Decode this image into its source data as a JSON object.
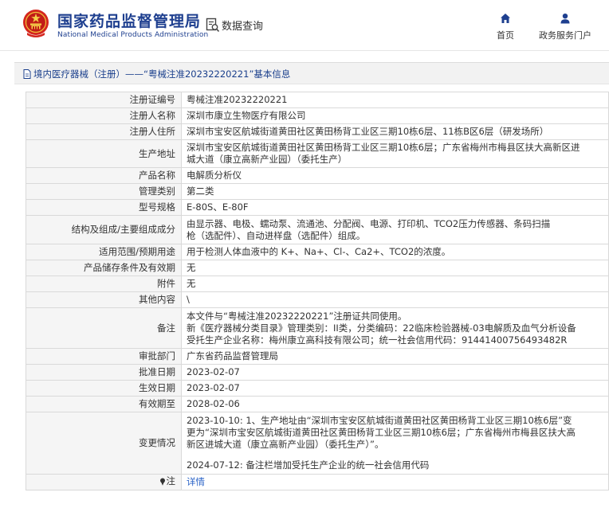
{
  "header": {
    "site_title": "国家药品监督管理局",
    "site_subtitle": "National Medical Products Administration",
    "emblem_icon": "national-emblem-icon",
    "query_icon": "data-query-icon",
    "query_title": "数据查询",
    "nav": [
      {
        "label": "首页",
        "icon": "home-icon"
      },
      {
        "label": "政务服务门户",
        "icon": "user-icon"
      }
    ],
    "brand_color": "#1e3f8f"
  },
  "breadcrumb": {
    "icon": "document-icon",
    "text": "境内医疗器械（注册）——“粤械注准20232220221”基本信息"
  },
  "fields": {
    "reg_no": {
      "label": "注册证编号",
      "value": "粤械注准20232220221"
    },
    "registrant": {
      "label": "注册人名称",
      "value": "深圳市康立生物医疗有限公司"
    },
    "registrant_address": {
      "label": "注册人住所",
      "value": "深圳市宝安区航城街道黄田社区黄田杨背工业区三期10栋6层、11栋B区6层（研发场所）"
    },
    "production_address": {
      "label": "生产地址",
      "lines": [
        "深圳市宝安区航城街道黄田社区黄田杨背工业区三期10栋6层；广东省梅州市梅县区扶大高新区进",
        "城大道（康立高新产业园）（委托生产）"
      ]
    },
    "product_name": {
      "label": "产品名称",
      "value": "电解质分析仪"
    },
    "category": {
      "label": "管理类别",
      "value": "第二类"
    },
    "model": {
      "label": "型号规格",
      "value": "E-80S、E-80F"
    },
    "composition": {
      "label": "结构及组成/主要组成成分",
      "lines": [
        "由显示器、电极、蠕动泵、流通池、分配阀、电源、打印机、TCO2压力传感器、条码扫描",
        "枪（选配件）、自动进样盘（选配件）组成。"
      ]
    },
    "intended_use": {
      "label": "适用范围/预期用途",
      "value": "用于检测人体血液中的 K+、Na+、Cl-、Ca2+、TCO2的浓度。"
    },
    "storage": {
      "label": "产品储存条件及有效期",
      "value": "无"
    },
    "attachment": {
      "label": "附件",
      "value": "无"
    },
    "other": {
      "label": "其他内容",
      "value": "\\"
    },
    "remarks": {
      "label": "备注",
      "lines": [
        "本文件与“粤械注准20232220221”注册证共同使用。",
        "新《医疗器械分类目录》管理类别：II类，分类编码：22临床检验器械-03电解质及血气分析设备",
        "受托生产企业名称：梅州康立高科技有限公司；统一社会信用代码：91441400756493482R"
      ]
    },
    "approval_dept": {
      "label": "审批部门",
      "value": "广东省药品监督管理局"
    },
    "approval_date": {
      "label": "批准日期",
      "value": "2023-02-07"
    },
    "effective_date": {
      "label": "生效日期",
      "value": "2023-02-07"
    },
    "expiry_date": {
      "label": "有效期至",
      "value": "2028-02-06"
    },
    "changes": {
      "label": "变更情况",
      "lines": [
        "2023-10-10: 1、生产地址由“深圳市宝安区航城街道黄田社区黄田杨背工业区三期10栋6层”变",
        "更为“深圳市宝安区航城街道黄田社区黄田杨背工业区三期10栋6层；广东省梅州市梅县区扶大高",
        "新区进城大道（康立高新产业园）（委托生产）”。"
      ],
      "lines2": [
        "2024-07-12: 备注栏增加受托生产企业的统一社会信用代码"
      ]
    },
    "note": {
      "label": "注",
      "icon": "note-pin-icon",
      "link": "详情"
    }
  }
}
